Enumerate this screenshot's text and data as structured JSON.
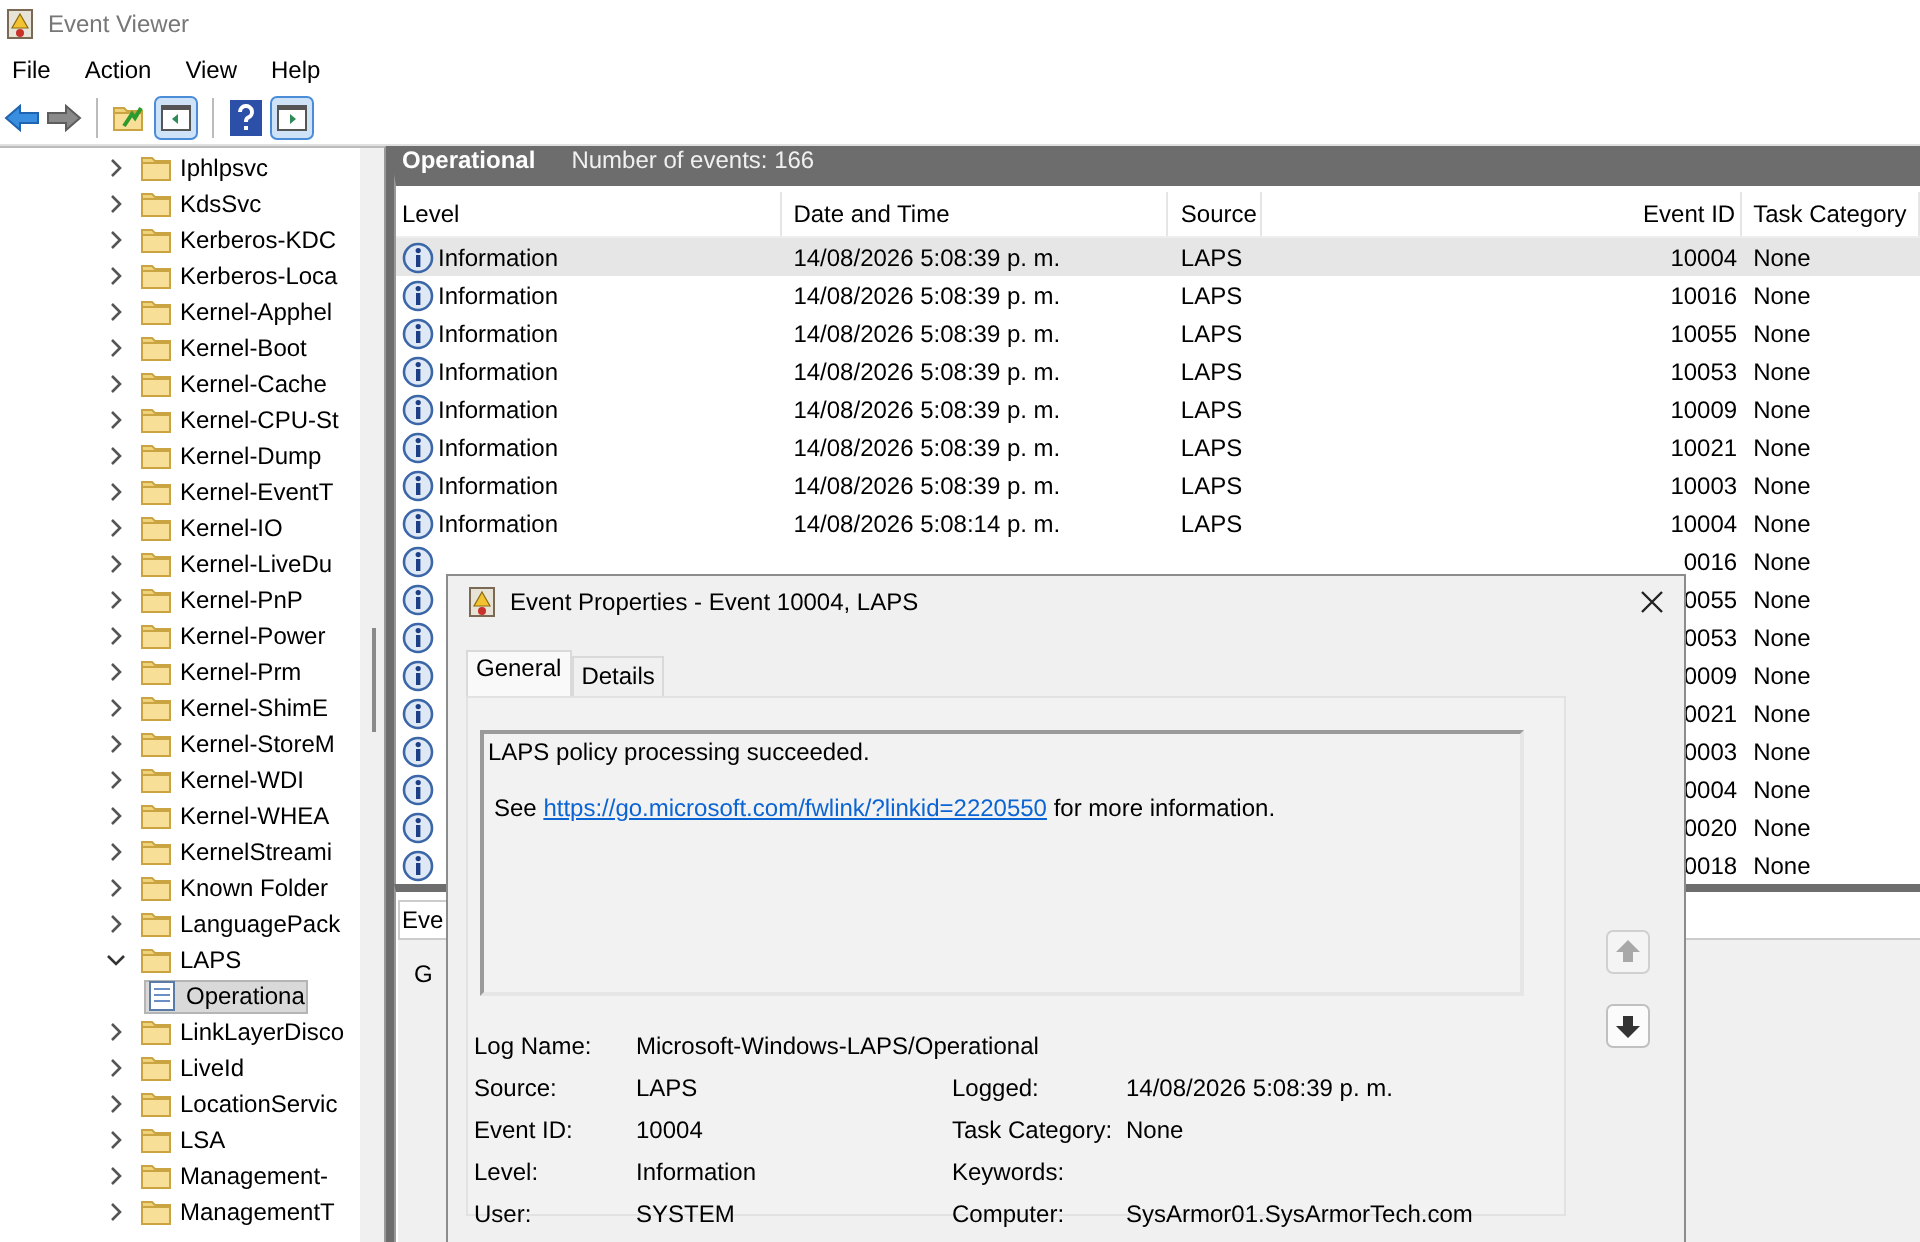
{
  "window": {
    "title": "Event Viewer"
  },
  "menu": [
    "File",
    "Action",
    "View",
    "Help"
  ],
  "tree": {
    "items": [
      {
        "label": "Iphlpsvc",
        "expanded": false,
        "selected": false
      },
      {
        "label": "KdsSvc",
        "expanded": false,
        "selected": false
      },
      {
        "label": "Kerberos-KDC",
        "expanded": false,
        "selected": false
      },
      {
        "label": "Kerberos-Loca",
        "expanded": false,
        "selected": false
      },
      {
        "label": "Kernel-Apphel",
        "expanded": false,
        "selected": false
      },
      {
        "label": "Kernel-Boot",
        "expanded": false,
        "selected": false
      },
      {
        "label": "Kernel-Cache",
        "expanded": false,
        "selected": false
      },
      {
        "label": "Kernel-CPU-St",
        "expanded": false,
        "selected": false
      },
      {
        "label": "Kernel-Dump",
        "expanded": false,
        "selected": false
      },
      {
        "label": "Kernel-EventT",
        "expanded": false,
        "selected": false
      },
      {
        "label": "Kernel-IO",
        "expanded": false,
        "selected": false
      },
      {
        "label": "Kernel-LiveDu",
        "expanded": false,
        "selected": false
      },
      {
        "label": "Kernel-PnP",
        "expanded": false,
        "selected": false
      },
      {
        "label": "Kernel-Power",
        "expanded": false,
        "selected": false
      },
      {
        "label": "Kernel-Prm",
        "expanded": false,
        "selected": false
      },
      {
        "label": "Kernel-ShimE",
        "expanded": false,
        "selected": false
      },
      {
        "label": "Kernel-StoreM",
        "expanded": false,
        "selected": false
      },
      {
        "label": "Kernel-WDI",
        "expanded": false,
        "selected": false
      },
      {
        "label": "Kernel-WHEA",
        "expanded": false,
        "selected": false
      },
      {
        "label": "KernelStreami",
        "expanded": false,
        "selected": false
      },
      {
        "label": "Known Folder",
        "expanded": false,
        "selected": false
      },
      {
        "label": "LanguagePack",
        "expanded": false,
        "selected": false
      },
      {
        "label": "LAPS",
        "expanded": true,
        "selected": false,
        "children": [
          {
            "label": "Operationa",
            "kind": "log",
            "selected": true
          }
        ]
      },
      {
        "label": "LinkLayerDisco",
        "expanded": false,
        "selected": false
      },
      {
        "label": "LiveId",
        "expanded": false,
        "selected": false
      },
      {
        "label": "LocationServic",
        "expanded": false,
        "selected": false
      },
      {
        "label": "LSA",
        "expanded": false,
        "selected": false
      },
      {
        "label": "Management-",
        "expanded": false,
        "selected": false
      },
      {
        "label": "ManagementT",
        "expanded": false,
        "selected": false
      }
    ]
  },
  "log_header": {
    "title": "Operational",
    "count": "Number of events: 166"
  },
  "table": {
    "columns": [
      "Level",
      "Date and Time",
      "Source",
      "Event ID",
      "Task Category"
    ],
    "rows": [
      {
        "kind": "information",
        "level": "Information",
        "date": "14/08/2026 5:08:39 p. m.",
        "source": "LAPS",
        "event_id": "10004",
        "task_category": "None",
        "selected": true
      },
      {
        "kind": "information",
        "level": "Information",
        "date": "14/08/2026 5:08:39 p. m.",
        "source": "LAPS",
        "event_id": "10016",
        "task_category": "None",
        "selected": false
      },
      {
        "kind": "information",
        "level": "Information",
        "date": "14/08/2026 5:08:39 p. m.",
        "source": "LAPS",
        "event_id": "10055",
        "task_category": "None",
        "selected": false
      },
      {
        "kind": "information",
        "level": "Information",
        "date": "14/08/2026 5:08:39 p. m.",
        "source": "LAPS",
        "event_id": "10053",
        "task_category": "None",
        "selected": false
      },
      {
        "kind": "information",
        "level": "Information",
        "date": "14/08/2026 5:08:39 p. m.",
        "source": "LAPS",
        "event_id": "10009",
        "task_category": "None",
        "selected": false
      },
      {
        "kind": "information",
        "level": "Information",
        "date": "14/08/2026 5:08:39 p. m.",
        "source": "LAPS",
        "event_id": "10021",
        "task_category": "None",
        "selected": false
      },
      {
        "kind": "information",
        "level": "Information",
        "date": "14/08/2026 5:08:39 p. m.",
        "source": "LAPS",
        "event_id": "10003",
        "task_category": "None",
        "selected": false
      },
      {
        "kind": "information",
        "level": "Information",
        "date": "14/08/2026 5:08:14 p. m.",
        "source": "LAPS",
        "event_id": "10004",
        "task_category": "None",
        "selected": false
      },
      {
        "kind": "information",
        "event_id": "0016",
        "task_category": "None",
        "selected": false
      },
      {
        "kind": "information",
        "event_id": "0055",
        "task_category": "None",
        "selected": false
      },
      {
        "kind": "information",
        "event_id": "0053",
        "task_category": "None",
        "selected": false
      },
      {
        "kind": "information",
        "event_id": "0009",
        "task_category": "None",
        "selected": false
      },
      {
        "kind": "information",
        "event_id": "0021",
        "task_category": "None",
        "selected": false
      },
      {
        "kind": "information",
        "event_id": "0003",
        "task_category": "None",
        "selected": false
      },
      {
        "kind": "information",
        "event_id": "0004",
        "task_category": "None",
        "selected": false
      },
      {
        "kind": "information",
        "event_id": "0020",
        "task_category": "None",
        "selected": false
      },
      {
        "kind": "information",
        "event_id": "0018",
        "task_category": "None",
        "selected": false
      }
    ]
  },
  "lower_pane": {
    "tab": "Eve",
    "inner_tab": "G"
  },
  "dialog": {
    "title": "Event Properties - Event 10004, LAPS",
    "tabs": [
      {
        "label": "General",
        "selected": true
      },
      {
        "label": "Details",
        "selected": false
      }
    ],
    "message": "LAPS policy processing succeeded.",
    "see": {
      "before": "See",
      "link": "https://go.microsoft.com/fwlink/?linkid=2220550",
      "after": "for more information."
    },
    "fields": [
      {
        "label": "Log Name:",
        "value": "Microsoft-Windows-LAPS/Operational",
        "wide": true
      },
      {
        "label": "Source:",
        "value": "LAPS"
      },
      {
        "label": "Logged:",
        "value": "14/08/2026 5:08:39 p. m."
      },
      {
        "label": "Event ID:",
        "value": "10004"
      },
      {
        "label": "Task Category:",
        "value": "None"
      },
      {
        "label": "Level:",
        "value": "Information"
      },
      {
        "label": "Keywords:"
      },
      {
        "label": "User:",
        "value": "SYSTEM"
      },
      {
        "label": "Computer:",
        "value": "SysArmor01.SysArmorTech.com"
      }
    ]
  }
}
